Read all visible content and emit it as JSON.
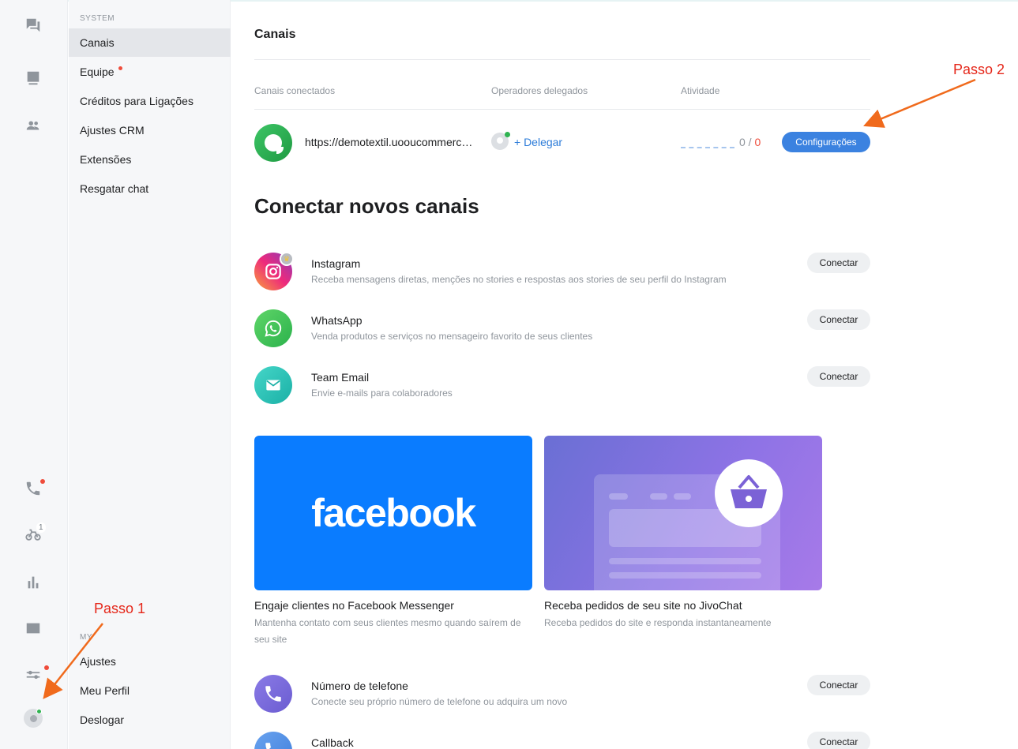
{
  "rail": {
    "icons": [
      "chat-icon",
      "contacts-icon",
      "team-icon",
      "phone-icon",
      "bike-icon",
      "stats-icon",
      "billing-icon",
      "settings-icon",
      "avatar-icon"
    ],
    "bike_badge": "1"
  },
  "menu": {
    "system_label": "SYSTEM",
    "items": [
      {
        "label": "Canais",
        "active": true
      },
      {
        "label": "Equipe",
        "dot": true
      },
      {
        "label": "Créditos para Ligações"
      },
      {
        "label": "Ajustes CRM"
      },
      {
        "label": "Extensões"
      },
      {
        "label": "Resgatar chat"
      }
    ],
    "my_label": "MY",
    "bottom_items": [
      {
        "label": "Ajustes"
      },
      {
        "label": "Meu Perfil"
      },
      {
        "label": "Deslogar"
      }
    ]
  },
  "main": {
    "title": "Canais",
    "columns": {
      "connected": "Canais conectados",
      "operators": "Operadores delegados",
      "activity": "Atividade"
    },
    "channel": {
      "url": "https://demotextil.uooucommerce.com",
      "delegate": "+ Delegar",
      "activity_a": "0",
      "activity_sep": " / ",
      "activity_b": "0",
      "config_button": "Configurações"
    },
    "connect_title": "Conectar novos canais",
    "channels_new": [
      {
        "title": "Instagram",
        "desc": "Receba mensagens diretas, menções no stories e respostas aos stories de seu perfil do Instagram",
        "button": "Conectar"
      },
      {
        "title": "WhatsApp",
        "desc": "Venda produtos e serviços no mensageiro favorito de seus clientes",
        "button": "Conectar"
      },
      {
        "title": "Team Email",
        "desc": "Envie e-mails para colaboradores",
        "button": "Conectar"
      }
    ],
    "cards": [
      {
        "logo": "facebook",
        "title": "Engaje clientes no Facebook Messenger",
        "desc": "Mantenha contato com seus clientes mesmo quando saírem de seu site"
      },
      {
        "title": "Receba pedidos de seu site no JivoChat",
        "desc": "Receba pedidos do site e responda instantaneamente"
      }
    ],
    "channels_more": [
      {
        "title": "Número de telefone",
        "desc": "Conecte seu próprio número de telefone ou adquira um novo",
        "button": "Conectar"
      },
      {
        "title": "Callback",
        "button": "Conectar"
      }
    ]
  },
  "annotations": {
    "step1": "Passo 1",
    "step2": "Passo 2",
    "color": "#e5271a",
    "arrow_color": "#f06a1c"
  },
  "colors": {
    "primary": "#3b82e0",
    "facebook": "#0a7cff",
    "alert": "#ef4c3b",
    "online": "#2fb351"
  }
}
